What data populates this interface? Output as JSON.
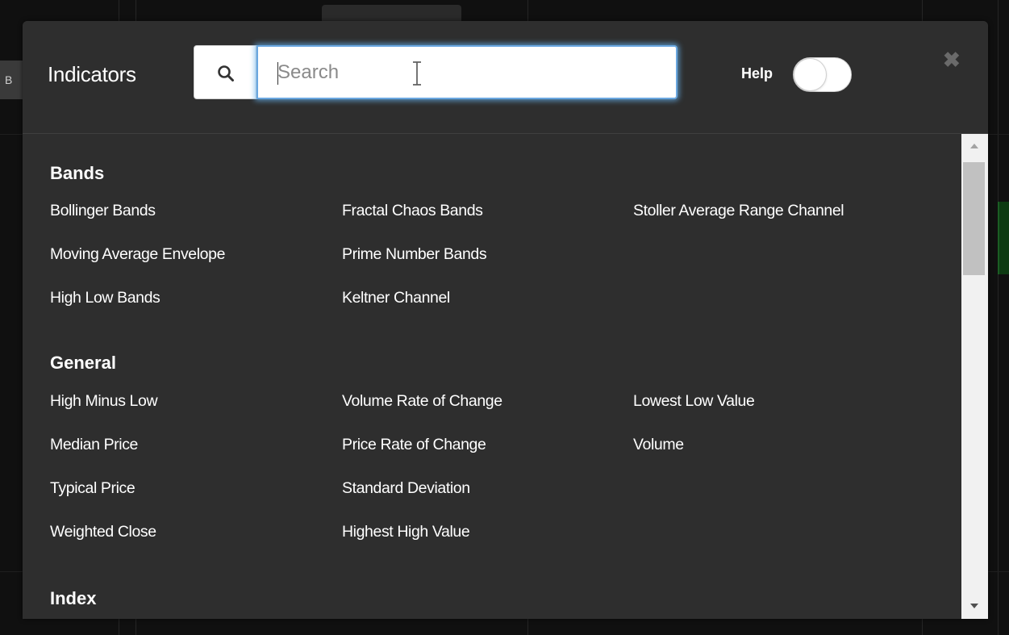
{
  "background": {
    "left_button_label": "B"
  },
  "dialog": {
    "title": "Indicators",
    "search": {
      "placeholder": "Search",
      "value": ""
    },
    "help_label": "Help",
    "help_toggle_on": false,
    "close_glyph": "✖"
  },
  "categories": [
    {
      "name": "Bands",
      "columns": [
        [
          "Bollinger Bands",
          "Moving Average Envelope",
          "High Low Bands"
        ],
        [
          "Fractal Chaos Bands",
          "Prime Number Bands",
          "Keltner Channel"
        ],
        [
          "Stoller Average Range Channel"
        ]
      ]
    },
    {
      "name": "General",
      "columns": [
        [
          "High Minus Low",
          "Median Price",
          "Typical Price",
          "Weighted Close"
        ],
        [
          "Volume Rate of Change",
          "Price Rate of Change",
          "Standard Deviation",
          "Highest High Value"
        ],
        [
          "Lowest Low Value",
          "Volume"
        ]
      ]
    },
    {
      "name": "Index",
      "columns": [
        [],
        [],
        []
      ]
    }
  ],
  "colors": {
    "dialog_bg": "#2e2e2e",
    "text": "#ffffff",
    "focus_ring": "#66afe9",
    "close_icon": "#6a6a6a"
  }
}
